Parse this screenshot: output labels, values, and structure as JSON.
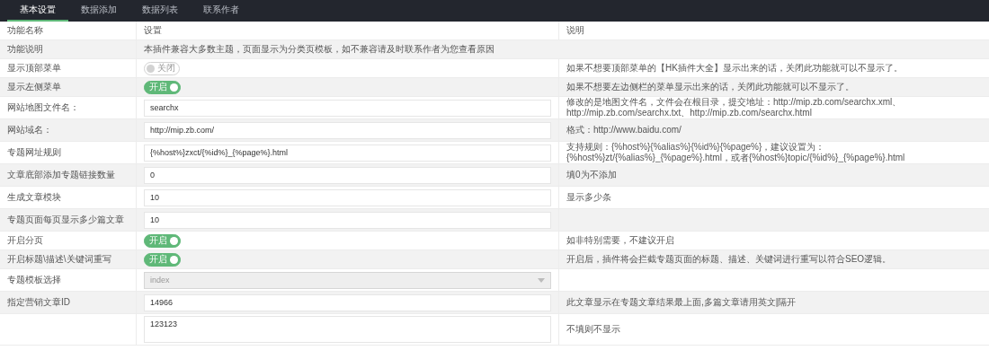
{
  "tabs": [
    {
      "label": "基本设置",
      "selected": true
    },
    {
      "label": "数据添加",
      "selected": false
    },
    {
      "label": "数据列表",
      "selected": false
    },
    {
      "label": "联系作者",
      "selected": false
    }
  ],
  "table": {
    "columns": [
      "功能名称",
      "设置",
      "说明"
    ],
    "rows": [
      {
        "label": "功能说明",
        "kind": "text",
        "value": "本插件兼容大多数主题，页面显示为分类页模板，如不兼容请及时联系作者为您查看原因"
      },
      {
        "label": "显示顶部菜单",
        "kind": "toggle",
        "on": false,
        "state_label": "关闭",
        "description": "如果不想要顶部菜单的【HK插件大全】显示出来的话，关闭此功能就可以不显示了。"
      },
      {
        "label": "显示左侧菜单",
        "kind": "toggle",
        "on": true,
        "state_label": "开启",
        "description": "如果不想要左边侧栏的菜单显示出来的话，关闭此功能就可以不显示了。"
      },
      {
        "label": "网站地图文件名：",
        "kind": "input",
        "value": "searchx",
        "description": "修改的是地图文件名，文件会在根目录，提交地址：http://mip.zb.com/searchx.xml、http://mip.zb.com/searchx.txt、http://mip.zb.com/searchx.html"
      },
      {
        "label": "网站域名：",
        "kind": "input",
        "value": "http://mip.zb.com/",
        "description": "格式：http://www.baidu.com/"
      },
      {
        "label": "专题网址规则",
        "kind": "input",
        "value": "{%host%}zxct/{%id%}_{%page%}.html",
        "description": "支持规则：{%host%}{%alias%}{%id%}{%page%}，建议设置为：{%host%}zt/{%alias%}_{%page%}.html，或者{%host%}topic/{%id%}_{%page%}.html"
      },
      {
        "label": "文章底部添加专题链接数量",
        "kind": "input",
        "value": "0",
        "description": "填0为不添加"
      },
      {
        "label": "生成文章模块",
        "kind": "input",
        "value": "10",
        "description": "显示多少条"
      },
      {
        "label": "专题页面每页显示多少篇文章",
        "kind": "input",
        "value": "10"
      },
      {
        "label": "开启分页",
        "kind": "toggle",
        "on": true,
        "state_label": "开启",
        "description": "如非特别需要，不建议开启"
      },
      {
        "label": "开启标题\\描述\\关键词重写",
        "kind": "toggle",
        "on": true,
        "state_label": "开启",
        "description": "开启后，插件将会拦截专题页面的标题、描述、关键词进行重写以符合SEO逻辑。"
      },
      {
        "label": "专题模板选择",
        "kind": "select",
        "value": "index",
        "disabled": true
      },
      {
        "label": "指定营销文章ID",
        "kind": "input",
        "value": "14966",
        "description": "此文章显示在专题文章结果最上面,多篇文章请用英文|隔开"
      },
      {
        "label": "",
        "kind": "textarea",
        "value": "123123",
        "description": "不填则不显示"
      }
    ]
  }
}
